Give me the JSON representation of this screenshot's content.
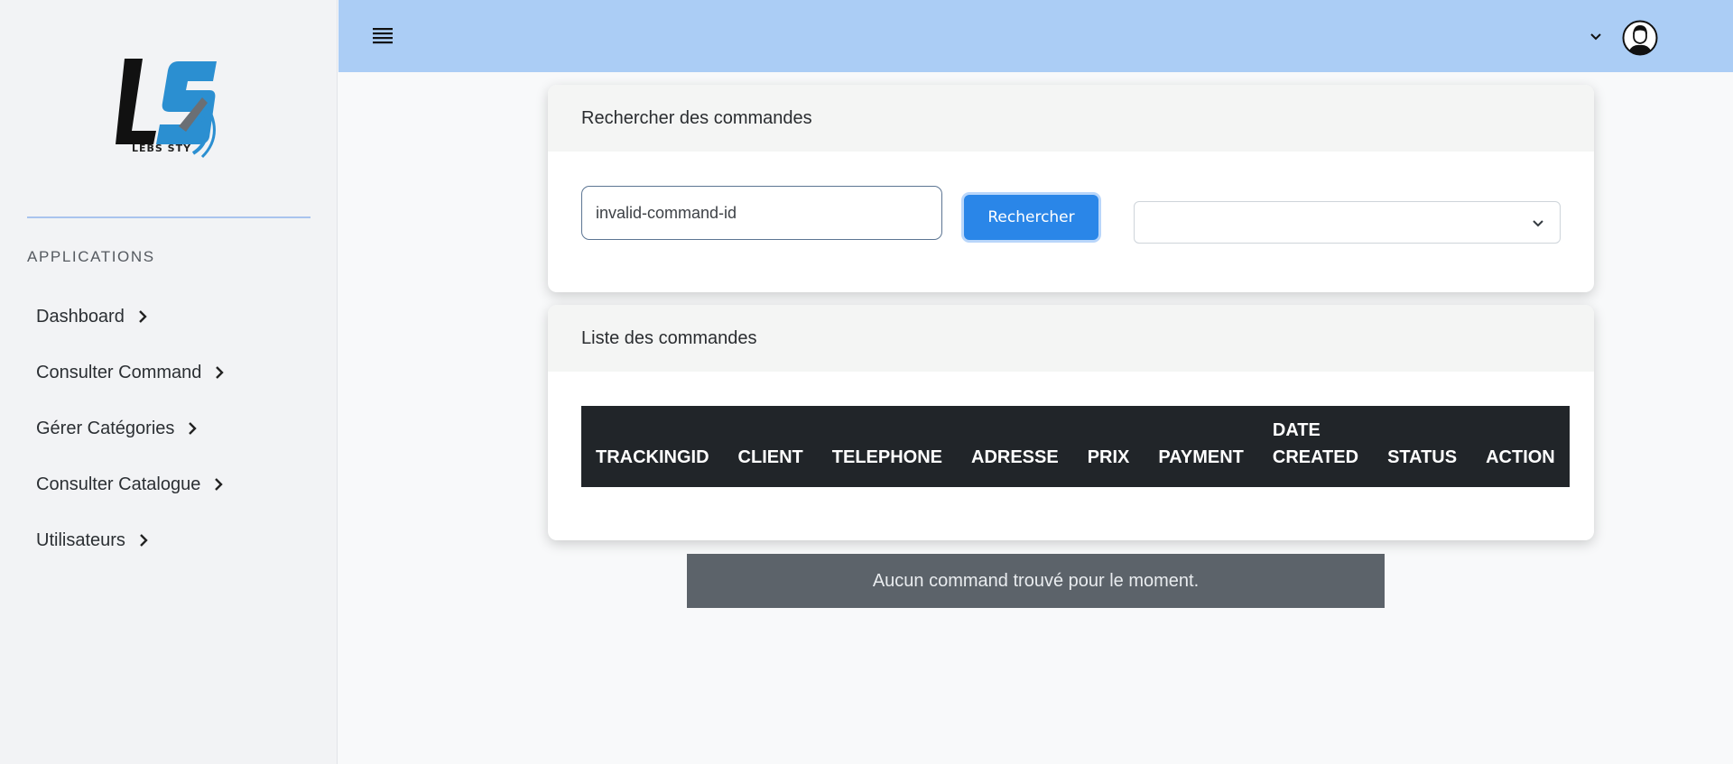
{
  "sidebar": {
    "logo_text": "LEBS STY",
    "section_heading": "APPLICATIONS",
    "items": [
      {
        "label": "Dashboard"
      },
      {
        "label": "Consulter Command"
      },
      {
        "label": "Gérer Catégories"
      },
      {
        "label": "Consulter Catalogue"
      },
      {
        "label": "Utilisateurs"
      }
    ]
  },
  "topbar": {
    "icons": [
      "menu-icon",
      "chevron-down-icon",
      "user-avatar-icon"
    ]
  },
  "search_card": {
    "title": "Rechercher des commandes",
    "input_value": "invalid-command-id",
    "button_label": "Rechercher",
    "select_value": ""
  },
  "list_card": {
    "title": "Liste des commandes",
    "columns": [
      "TRACKINGID",
      "CLIENT",
      "TELEPHONE",
      "ADRESSE",
      "PRIX",
      "PAYMENT",
      "DATE CREATED",
      "STATUS",
      "ACTION"
    ],
    "rows": []
  },
  "empty_message": "Aucun command trouvé pour le moment.",
  "colors": {
    "topbar": "#abcdf5",
    "primary_button": "#2a86e8",
    "table_header": "#212529",
    "alert_bg": "#5c636a"
  }
}
